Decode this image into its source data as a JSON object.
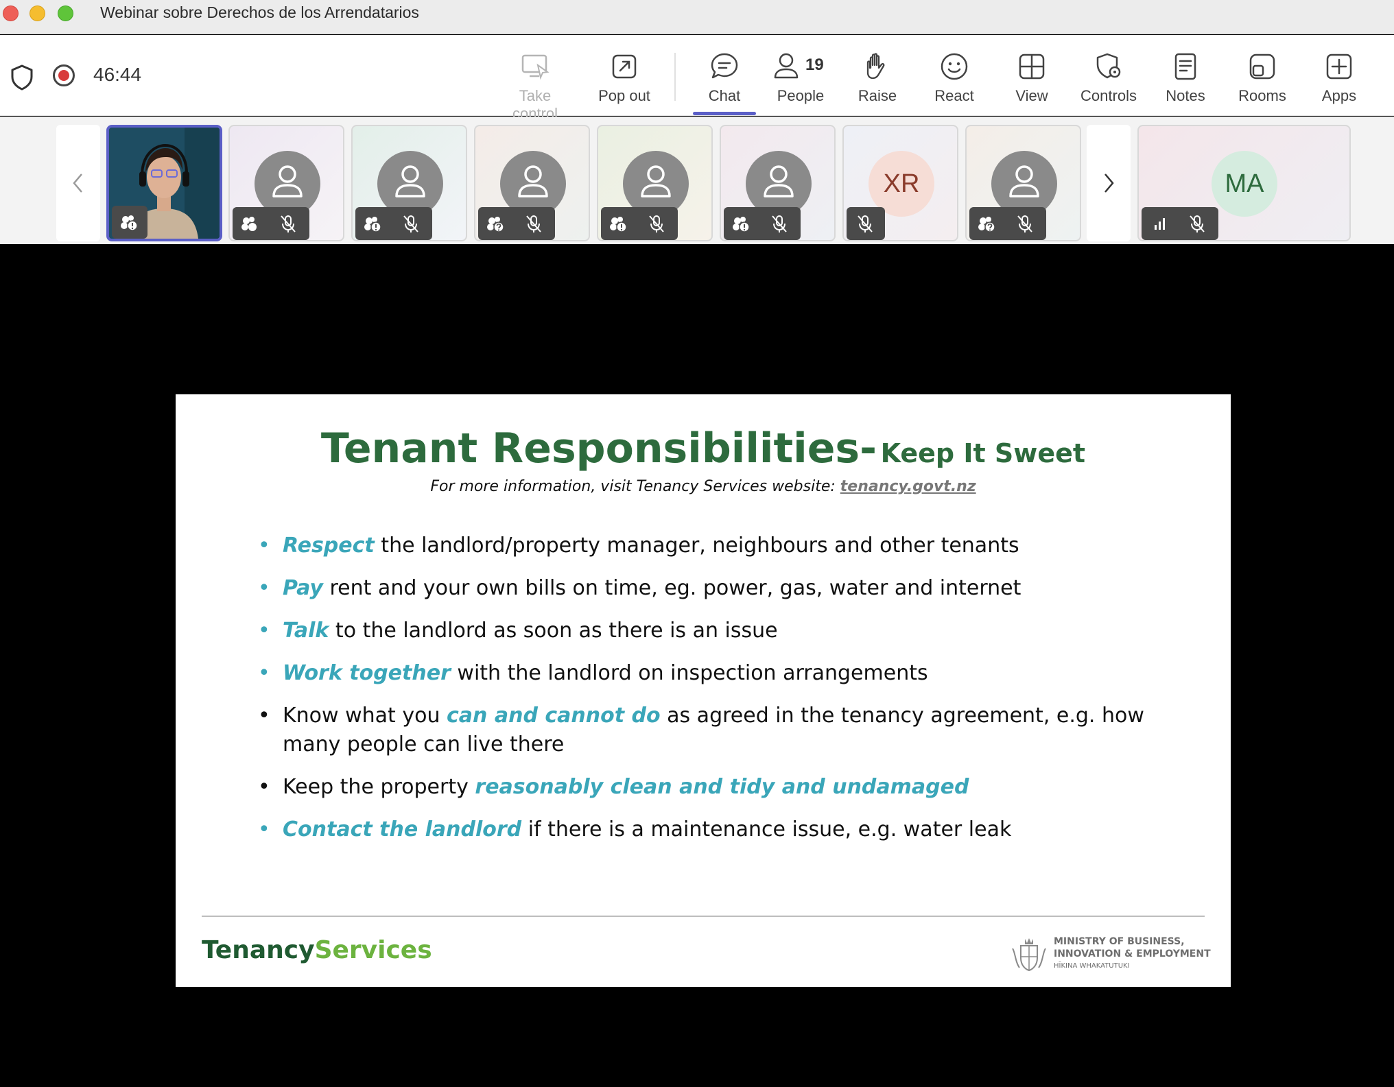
{
  "window": {
    "title": "Webinar sobre Derechos de los Arrendatarios"
  },
  "meeting": {
    "timer": "46:44",
    "status_icons": [
      "shield-icon",
      "recording-icon"
    ]
  },
  "toolbar": {
    "take_control": "Take control",
    "pop_out": "Pop out",
    "chat": "Chat",
    "people": "People",
    "people_count": "19",
    "raise": "Raise",
    "react": "React",
    "view": "View",
    "controls": "Controls",
    "notes": "Notes",
    "rooms": "Rooms",
    "apps": "Apps",
    "active_tab": "Chat"
  },
  "participants": [
    {
      "type": "video",
      "active": true,
      "icons": [
        "presence-warning-icon"
      ]
    },
    {
      "type": "avatar",
      "icons": [
        "presence-icon",
        "mic-off-icon"
      ]
    },
    {
      "type": "avatar",
      "icons": [
        "presence-warning-icon",
        "mic-off-icon"
      ]
    },
    {
      "type": "avatar",
      "icons": [
        "presence-unknown-icon",
        "mic-off-icon"
      ]
    },
    {
      "type": "avatar",
      "icons": [
        "presence-warning-icon",
        "mic-off-icon"
      ]
    },
    {
      "type": "avatar",
      "icons": [
        "presence-warning-icon",
        "mic-off-icon"
      ]
    },
    {
      "type": "initials",
      "initials": "XR",
      "icons": [
        "mic-off-icon"
      ]
    },
    {
      "type": "avatar",
      "icons": [
        "presence-unknown-icon",
        "mic-off-icon"
      ]
    },
    {
      "type": "initials",
      "initials": "MA",
      "icons": [
        "signal-icon",
        "mic-off-icon"
      ]
    }
  ],
  "slide": {
    "title_main": "Tenant Responsibilities-",
    "title_sub": "Keep It Sweet",
    "info_prefix": "For more information, visit Tenancy Services website: ",
    "info_link": "tenancy.govt.nz",
    "bullets": [
      {
        "highlight": "Respect",
        "rest": " the landlord/property manager, neighbours and other tenants"
      },
      {
        "highlight": "Pay",
        "rest": " rent and your own bills on time, eg. power, gas, water and internet"
      },
      {
        "highlight": "Talk",
        "rest": " to the landlord as soon as there is an issue"
      },
      {
        "highlight": "Work together",
        "rest": " with the landlord on inspection arrangements"
      },
      {
        "pre": "Know what you ",
        "highlight": "can and cannot do",
        "rest": " as agreed in the tenancy agreement, e.g. how many people can live there"
      },
      {
        "pre": "Keep the property ",
        "highlight": "reasonably clean and tidy and undamaged",
        "rest": ""
      },
      {
        "highlight": "Contact the landlord",
        "rest": " if there is a maintenance issue, e.g. water leak"
      }
    ],
    "logo_part1": "Tenancy",
    "logo_part2": "Services",
    "ministry_line1": "MINISTRY OF BUSINESS,",
    "ministry_line2": "INNOVATION & EMPLOYMENT",
    "ministry_line3": "HĪKINA WHAKATUTUKI"
  },
  "colors": {
    "accent": "#5b5fc7",
    "slide_title": "#2d6b3d",
    "slide_highlight": "#3aa6b9",
    "logo_dark": "#1f5a31",
    "logo_light": "#6cb33f",
    "recording": "#d83b3b"
  }
}
